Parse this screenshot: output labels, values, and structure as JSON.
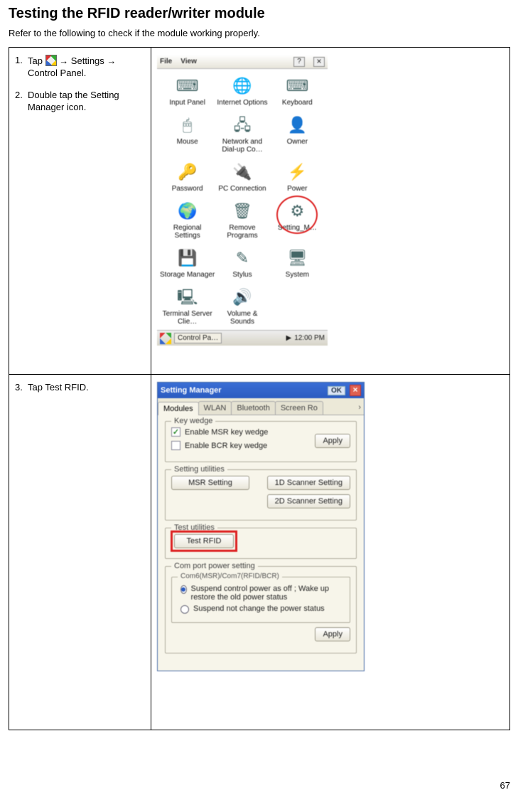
{
  "page": {
    "title": "Testing the RFID reader/writer module",
    "intro": "Refer to the following to check if the module working properly.",
    "number": "67"
  },
  "steps": {
    "s1": {
      "num": "1.",
      "pre": "Tap ",
      "post": " → Settings → Control Panel."
    },
    "s2": {
      "num": "2.",
      "text": "Double tap the Setting Manager icon."
    },
    "s3": {
      "num": "3.",
      "text": "Tap Test RFID."
    }
  },
  "cp": {
    "menu_file": "File",
    "menu_view": "View",
    "help": "?",
    "close": "×",
    "items": [
      {
        "icon": "⌨",
        "label": "Input Panel"
      },
      {
        "icon": "🌐",
        "label": "Internet Options"
      },
      {
        "icon": "⌨",
        "label": "Keyboard"
      },
      {
        "icon": "🖱",
        "label": "Mouse"
      },
      {
        "icon": "🖧",
        "label": "Network and Dial-up Co…"
      },
      {
        "icon": "👤",
        "label": "Owner"
      },
      {
        "icon": "🔑",
        "label": "Password"
      },
      {
        "icon": "🔌",
        "label": "PC Connection"
      },
      {
        "icon": "⚡",
        "label": "Power"
      },
      {
        "icon": "🌍",
        "label": "Regional Settings"
      },
      {
        "icon": "🗑",
        "label": "Remove Programs"
      },
      {
        "icon": "⚙",
        "label": "Setting_M…",
        "highlight": true
      },
      {
        "icon": "💾",
        "label": "Storage Manager"
      },
      {
        "icon": "✎",
        "label": "Stylus"
      },
      {
        "icon": "🖥",
        "label": "System"
      },
      {
        "icon": "🖳",
        "label": "Terminal Server Clie…"
      },
      {
        "icon": "🔊",
        "label": "Volume & Sounds"
      }
    ],
    "taskbar_app": "Control Pa…",
    "taskbar_time": "12:00 PM"
  },
  "sm": {
    "title": "Setting Manager",
    "ok": "OK",
    "close": "×",
    "tabs": [
      "Modules",
      "WLAN",
      "Bluetooth",
      "Screen Ro"
    ],
    "keywedge": {
      "legend": "Key wedge",
      "msr": "Enable MSR key wedge",
      "bcr": "Enable BCR key wedge",
      "apply": "Apply"
    },
    "setting_util": {
      "legend": "Setting utilities",
      "msr_setting": "MSR Setting",
      "scan1d": "1D Scanner Setting",
      "scan2d": "2D Scanner Setting"
    },
    "test_util": {
      "legend": "Test utilities",
      "test_rfid": "Test RFID"
    },
    "comport": {
      "legend": "Com port power setting",
      "sublegend": "Com6(MSR)/Com7(RFID/BCR)",
      "opt1": "Suspend control power as off ; Wake up restore the old power status",
      "opt2": "Suspend not change the power status",
      "apply": "Apply"
    }
  }
}
